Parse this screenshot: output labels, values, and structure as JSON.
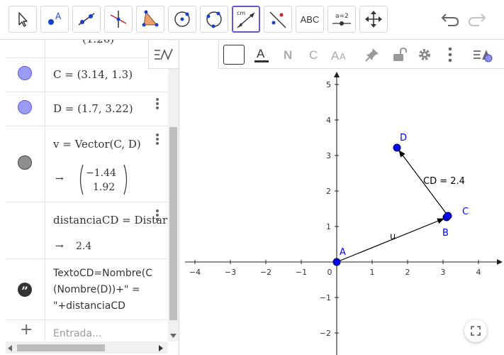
{
  "toolbar": {
    "tools": [
      {
        "name": "move-tool",
        "label": ""
      },
      {
        "name": "point-tool",
        "label": "A"
      },
      {
        "name": "line-tool",
        "label": ""
      },
      {
        "name": "perpendicular-tool",
        "label": ""
      },
      {
        "name": "polygon-tool",
        "label": ""
      },
      {
        "name": "circle-tool",
        "label": ""
      },
      {
        "name": "circle-three-points-tool",
        "label": ""
      },
      {
        "name": "distance-tool",
        "label": "cm"
      },
      {
        "name": "reflect-tool",
        "label": ""
      },
      {
        "name": "text-tool",
        "label": "ABC"
      },
      {
        "name": "slider-tool",
        "label": "a=2"
      },
      {
        "name": "move-graphics-tool",
        "label": ""
      }
    ],
    "selected_tool": "distance-tool"
  },
  "algebra": {
    "partial_top": "(1.26)",
    "rows": [
      {
        "text": "C = (3.14, 1.3)",
        "color": "#9a9bf5"
      },
      {
        "text": "D = (1.7, 3.22)",
        "color": "#9a9bf5"
      },
      {
        "text": "v = Vector(C, D)",
        "arrow": "→",
        "matrix": [
          "−1.44",
          "1.92"
        ]
      },
      {
        "text": "distanciaCD = Distar",
        "arrow": "→",
        "output": "2.4"
      },
      {
        "lines": [
          "TextoCD=Nombre(C",
          "(Nombre(D))+\" =",
          "\"+distanciaCD"
        ]
      }
    ],
    "input_placeholder": "Entrada...",
    "add_symbol": "+"
  },
  "graphics": {
    "x_ticks": [
      "−4",
      "−3",
      "−2",
      "−1",
      "0",
      "1",
      "2",
      "3",
      "4"
    ],
    "y_ticks": [
      "5",
      "4",
      "3",
      "2",
      "1",
      "−1",
      "−2"
    ],
    "points": [
      {
        "label": "A",
        "x": 0,
        "y": 0
      },
      {
        "label": "B",
        "x": 3.1,
        "y": 1.26
      },
      {
        "label": "C",
        "x": 3.14,
        "y": 1.3
      },
      {
        "label": "D",
        "x": 1.7,
        "y": 3.22
      }
    ],
    "vector_label": "u",
    "distance_text": "CD = 2.4",
    "point_color": "#0000ff",
    "label_color": "#0000ff"
  }
}
